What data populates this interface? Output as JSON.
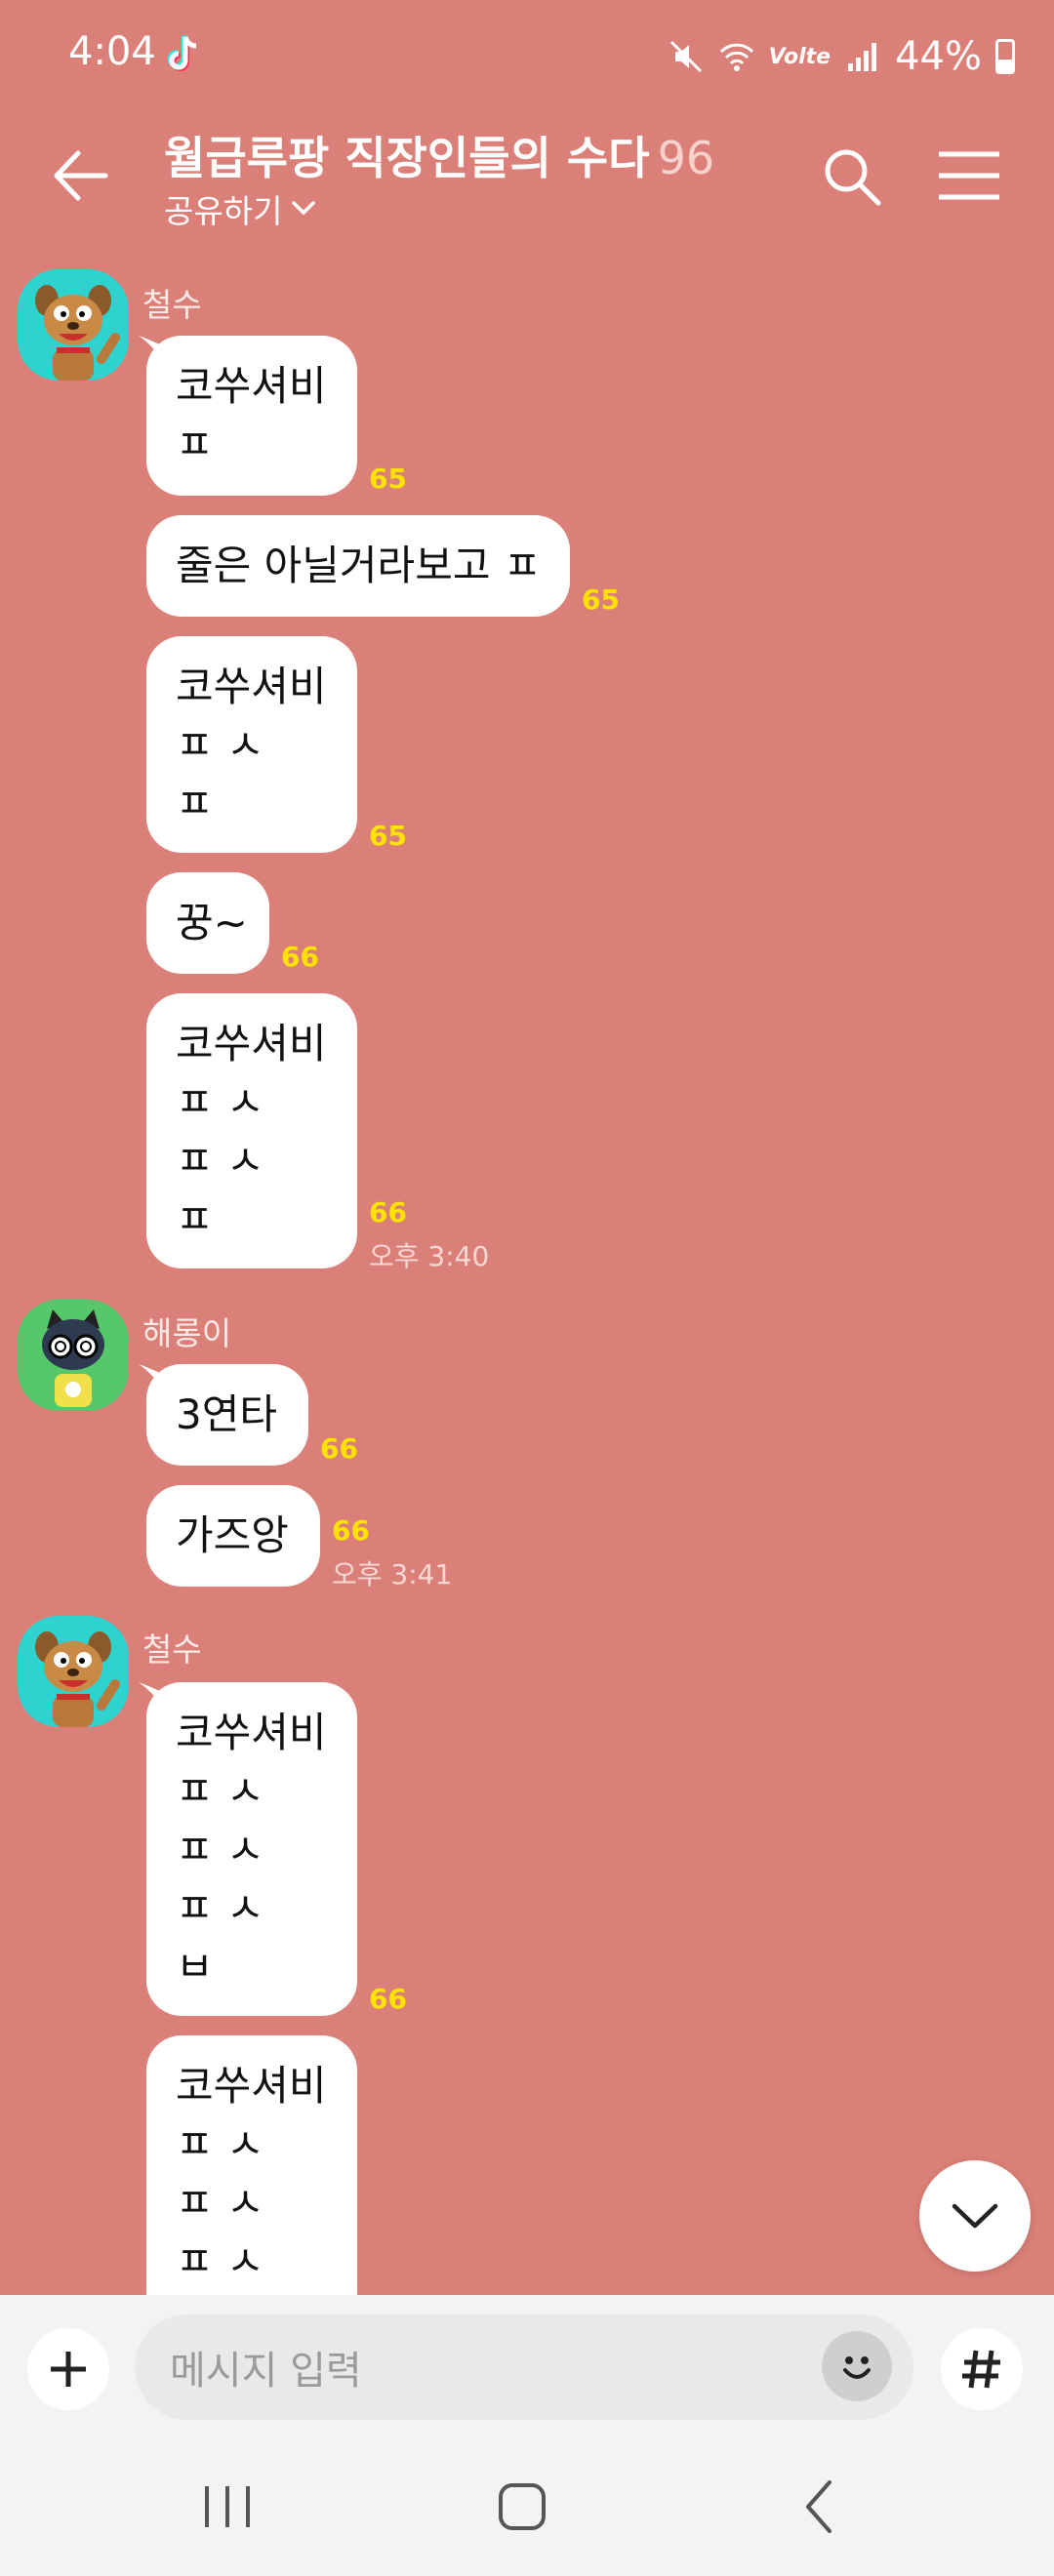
{
  "status_bar": {
    "time": "4:04",
    "battery": "44%",
    "network": "Volte"
  },
  "header": {
    "title": "월급루팡 직장인들의 수다",
    "member_count": "96",
    "share_label": "공유하기"
  },
  "messages": [
    {
      "sender": "철수",
      "avatar": "ryan-dog-avatar",
      "bubbles": [
        {
          "text": "코쑤셔비\nㅍ",
          "unread": "65"
        },
        {
          "text": "줄은 아닐거라보고 ㅍ",
          "unread": "65"
        },
        {
          "text": "코쑤셔비\nㅍ ㅅ\nㅍ",
          "unread": "65"
        },
        {
          "text": "꿍~",
          "unread": "66"
        },
        {
          "text": "코쑤셔비\nㅍ ㅅ\nㅍ ㅅ\nㅍ",
          "unread": "66",
          "time": "오후 3:40"
        }
      ]
    },
    {
      "sender": "해롱이",
      "avatar": "cat-avatar",
      "bubbles": [
        {
          "text": "3연타",
          "unread": "66"
        },
        {
          "text": "가즈앙",
          "unread": "66",
          "time": "오후 3:41"
        }
      ]
    },
    {
      "sender": "철수",
      "avatar": "ryan-dog-avatar",
      "bubbles": [
        {
          "text": "코쑤셔비\nㅍ ㅅ\nㅍ ㅅ\nㅍ ㅅ\nㅂ",
          "unread": "66"
        },
        {
          "text": "코쑤셔비\nㅍ ㅅ\nㅍ ㅅ\nㅍ ㅅ"
        }
      ]
    }
  ],
  "input": {
    "placeholder": "메시지 입력"
  },
  "colors": {
    "background": "#DA8078",
    "unread": "#FFE300",
    "bubble": "#FFFFFF"
  }
}
